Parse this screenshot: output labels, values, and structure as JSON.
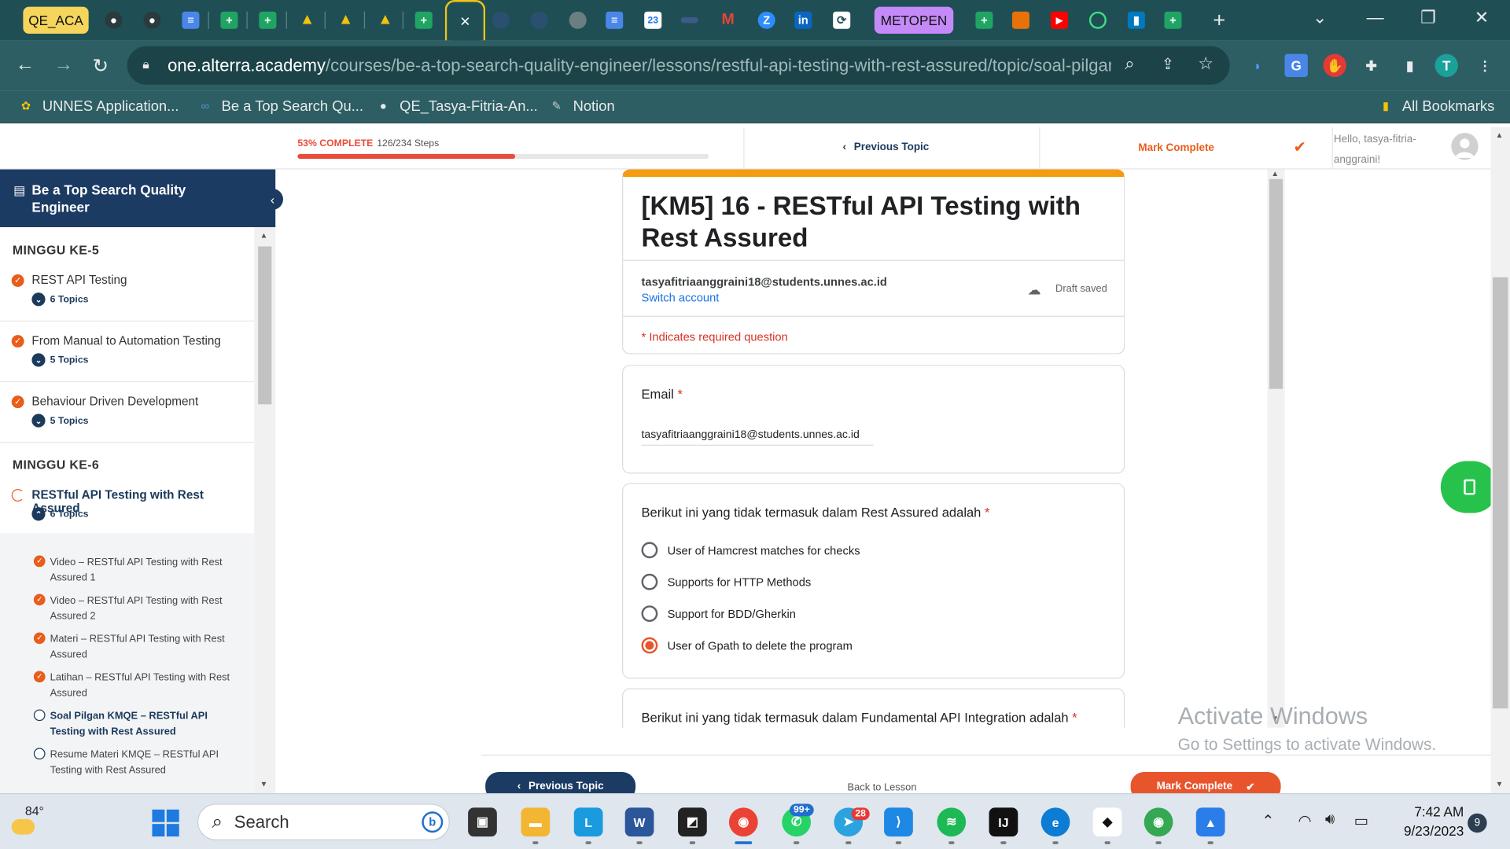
{
  "browser": {
    "tab_group_1": "QE_ACA",
    "tab_group_2": "METOPEN",
    "active_tab_close": "×",
    "new_tab": "+",
    "calendar_day": "23",
    "url_host": "one.alterra.academy",
    "url_path": "/courses/be-a-top-search-quality-engineer/lessons/restful-api-testing-with-rest-assured/topic/soal-pilgan-...",
    "profile_initial": "T",
    "bookmarks": [
      {
        "label": "UNNES Application..."
      },
      {
        "label": "Be a Top Search Qu..."
      },
      {
        "label": "QE_Tasya-Fitria-An..."
      },
      {
        "label": "Notion"
      }
    ],
    "all_bookmarks": "All Bookmarks"
  },
  "lesson_bar": {
    "progress_pct_label": "53% COMPLETE",
    "progress_steps": "126/234 Steps",
    "progress_fraction": 0.53,
    "previous_topic": "Previous Topic",
    "mark_complete": "Mark Complete",
    "greeting": "Hello, tasya-fitria-anggraini!"
  },
  "sidebar": {
    "course_title": "Be a Top Search Quality Engineer",
    "weeks": [
      {
        "label": "MINGGU KE-5"
      },
      {
        "label": "MINGGU KE-6"
      }
    ],
    "lessons": [
      {
        "title": "REST API Testing",
        "topics": "6 Topics"
      },
      {
        "title": "From Manual to Automation Testing",
        "topics": "5 Topics"
      },
      {
        "title": "Behaviour Driven Development",
        "topics": "5 Topics"
      },
      {
        "title": "RESTful API Testing with Rest Assured",
        "topics": "6 Topics"
      }
    ],
    "subtopics": [
      {
        "title": "Video – RESTful API Testing with Rest Assured 1",
        "done": true
      },
      {
        "title": "Video – RESTful API Testing with Rest Assured 2",
        "done": true
      },
      {
        "title": "Materi – RESTful API Testing with Rest Assured",
        "done": true
      },
      {
        "title": "Latihan – RESTful API Testing with Rest Assured",
        "done": true
      },
      {
        "title": "Soal Pilgan KMQE – RESTful API Testing with Rest Assured",
        "done": false
      },
      {
        "title": "Resume Materi KMQE – RESTful API Testing with Rest Assured",
        "done": false
      }
    ]
  },
  "form": {
    "title": "[KM5] 16 - RESTful API Testing with Rest Assured",
    "account_email": "tasyafitriaanggraini18@students.unnes.ac.id",
    "switch_account": "Switch account",
    "draft_status": "Draft saved",
    "required_note": "* Indicates required question",
    "required_star": "*",
    "email_label": "Email",
    "email_value": "tasyafitriaanggraini18@students.unnes.ac.id",
    "q1": {
      "label": "Berikut ini yang tidak termasuk dalam Rest Assured adalah",
      "options": [
        {
          "label": "User of Hamcrest matches for checks",
          "selected": false
        },
        {
          "label": "Supports for HTTP Methods",
          "selected": false
        },
        {
          "label": "Support for BDD/Gherkin",
          "selected": false
        },
        {
          "label": "User of Gpath to delete the program",
          "selected": true
        }
      ]
    },
    "q2": {
      "label": "Berikut ini yang tidak termasuk dalam Fundamental API Integration adalah"
    }
  },
  "bottom_nav": {
    "previous_topic": "Previous Topic",
    "back_to_lesson": "Back to Lesson",
    "mark_complete": "Mark Complete"
  },
  "watermark": {
    "line1": "Activate Windows",
    "line2": "Go to Settings to activate Windows."
  },
  "taskbar": {
    "temperature": "84°",
    "search_placeholder": "Search",
    "whatsapp_badge": "99+",
    "telegram_badge": "28",
    "time": "7:42 AM",
    "date": "9/23/2023",
    "notifications": "9"
  },
  "colors": {
    "accent_orange": "#e8552d",
    "navy": "#1c3b63",
    "form_header": "#f39c12",
    "chrome_frame": "#1f4f54"
  }
}
